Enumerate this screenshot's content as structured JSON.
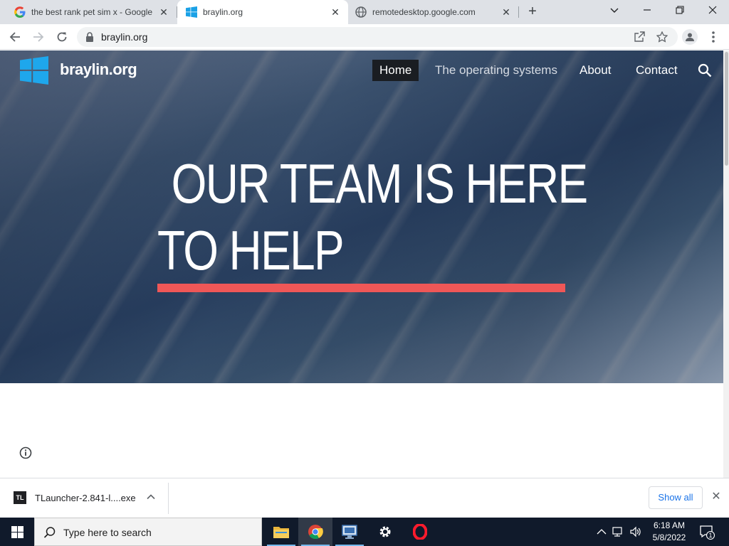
{
  "browser": {
    "tabs": [
      {
        "title": "the best rank pet sim x - Google",
        "favicon": "google-g-icon",
        "active": false
      },
      {
        "title": "braylin.org",
        "favicon": "windows-logo-icon",
        "active": true
      },
      {
        "title": "remotedesktop.google.com",
        "favicon": "globe-icon",
        "active": false
      }
    ],
    "new_tab_glyph": "+",
    "url": "braylin.org"
  },
  "site": {
    "name": "braylin.org",
    "nav": {
      "home": "Home",
      "os": "The operating systems",
      "about": "About",
      "contact": "Contact"
    },
    "headline_line1": "OUR TEAM IS HERE",
    "headline_line2": "TO HELP",
    "accent_color": "#ef5757"
  },
  "downloads": {
    "icon_text": "TL",
    "filename": "TLauncher-2.841-l....exe",
    "show_all": "Show all"
  },
  "taskbar": {
    "search_placeholder": "Type here to search",
    "time": "6:18 AM",
    "date": "5/8/2022",
    "notification_count": "1"
  }
}
